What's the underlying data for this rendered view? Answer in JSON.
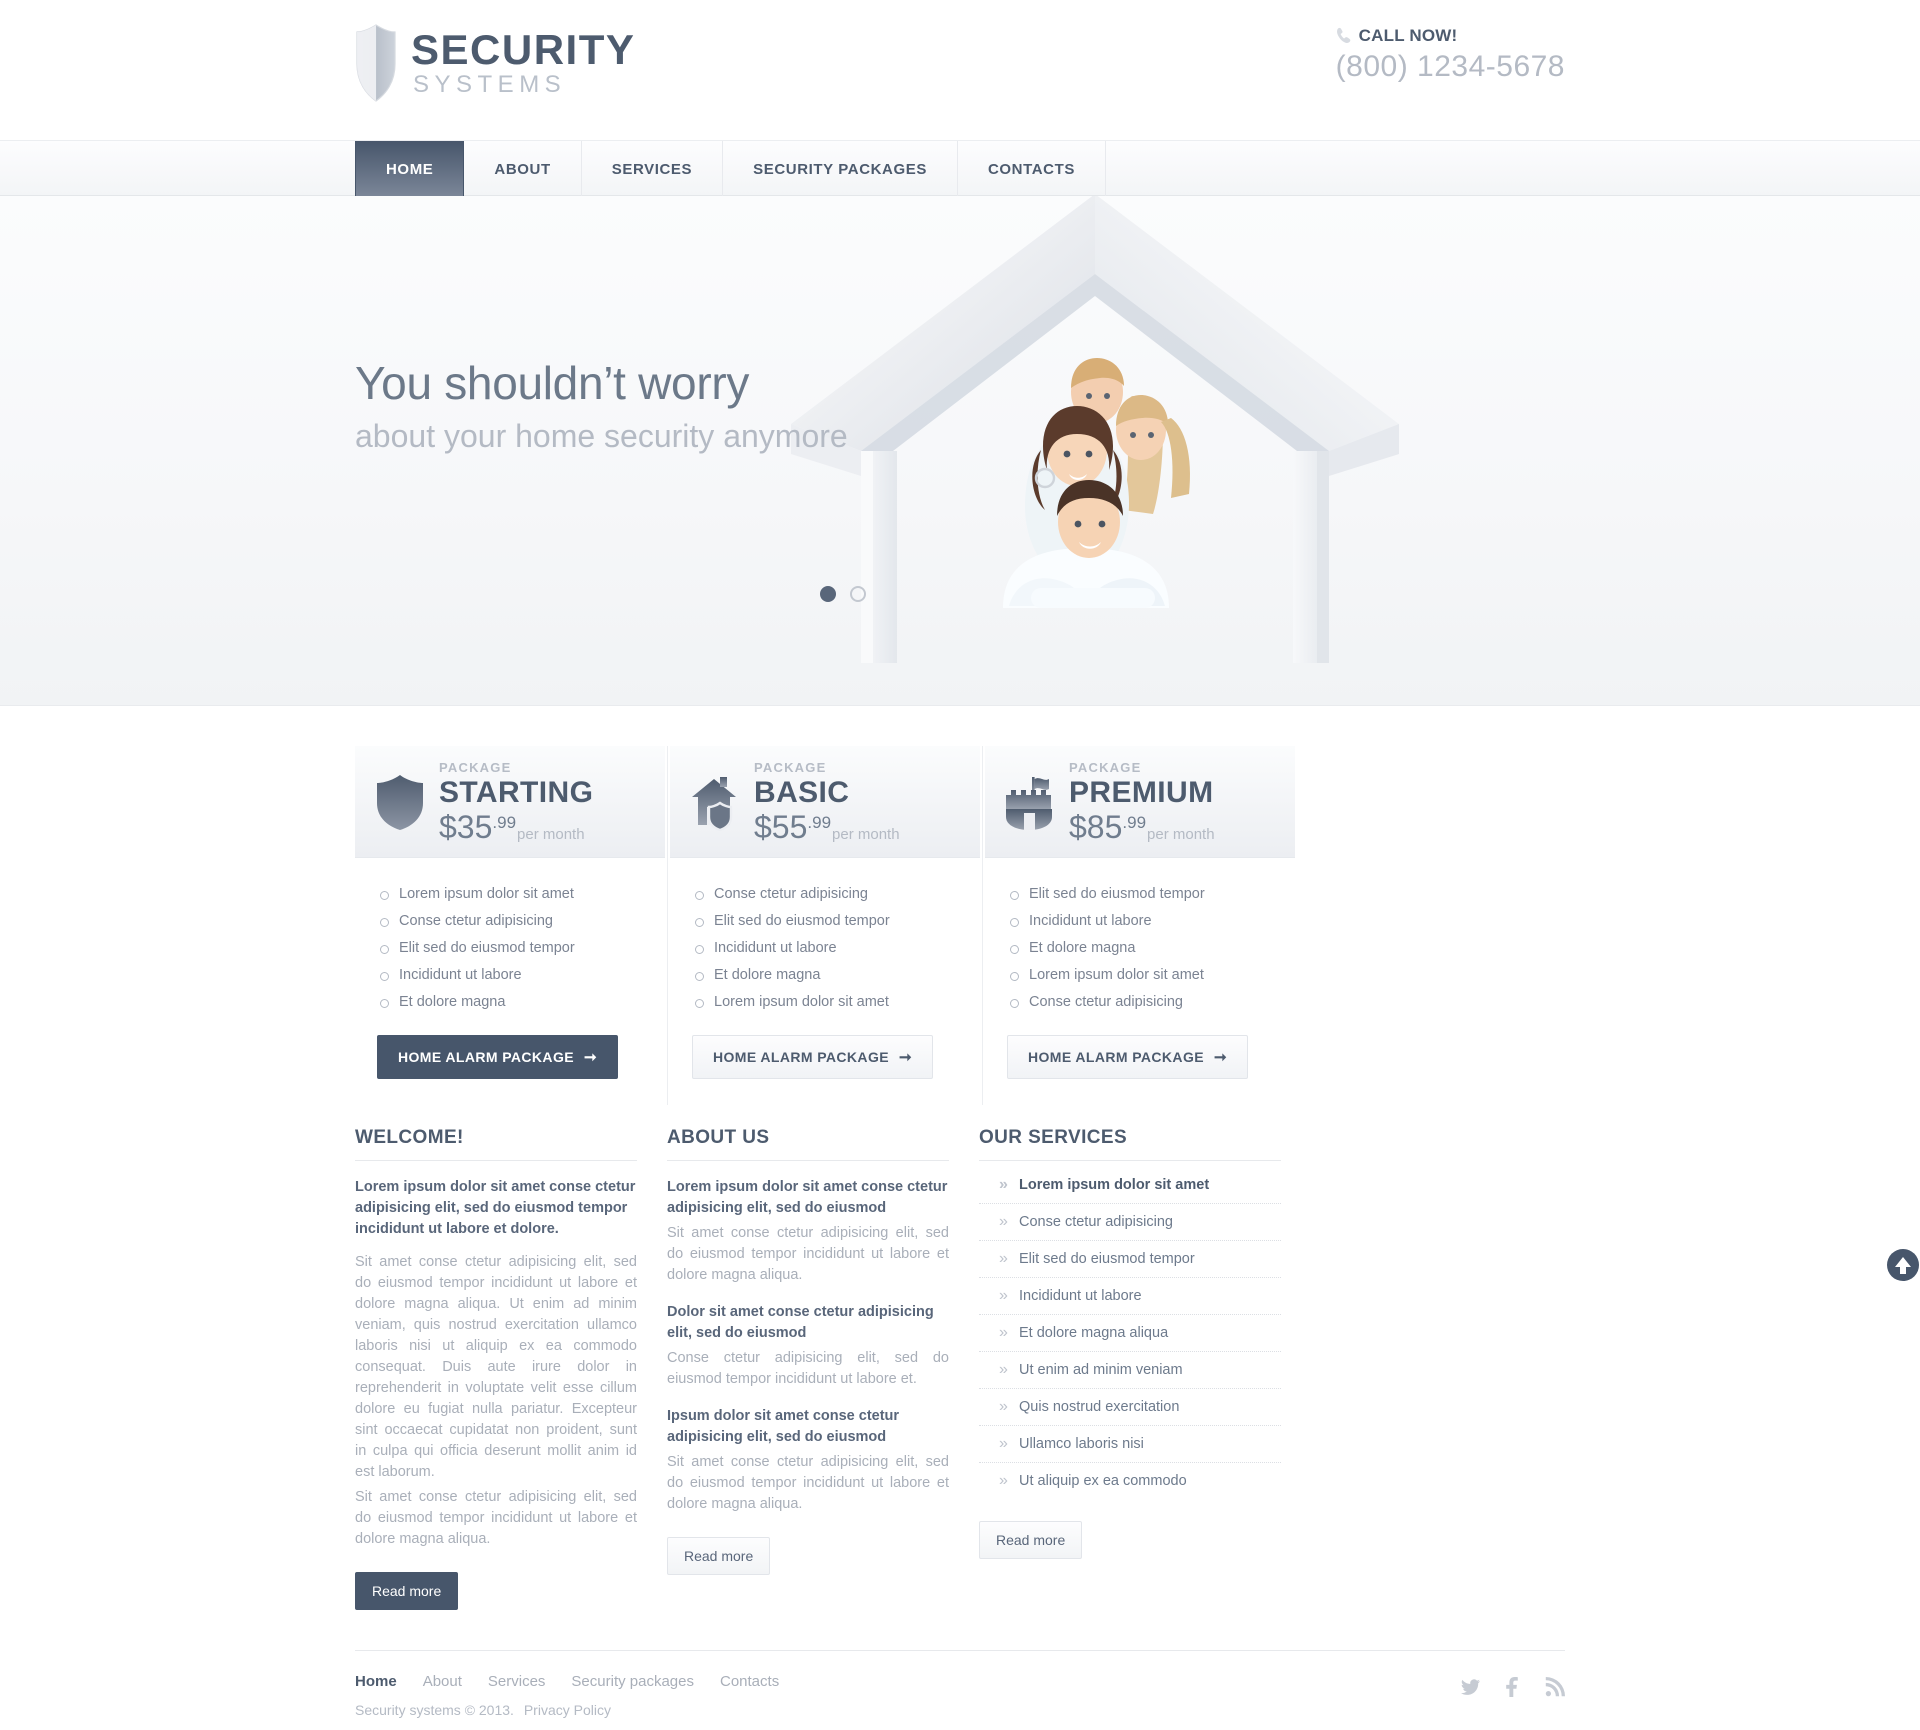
{
  "header": {
    "logo": {
      "title": "SECURITY",
      "subtitle": "SYSTEMS",
      "icon": "shield-icon"
    },
    "call_label": "CALL NOW!",
    "call_icon": "phone-icon",
    "phone": "(800) 1234-5678"
  },
  "nav": {
    "items": [
      {
        "label": "HOME",
        "active": true
      },
      {
        "label": "ABOUT",
        "active": false
      },
      {
        "label": "SERVICES",
        "active": false
      },
      {
        "label": "SECURITY PACKAGES",
        "active": false
      },
      {
        "label": "CONTACTS",
        "active": false
      }
    ]
  },
  "slider": {
    "headline": "You shouldn’t worry",
    "subheadline": "about your home security anymore",
    "image_alt": "family-under-house-icon",
    "pager": {
      "total": 2,
      "active": 1
    }
  },
  "packages": [
    {
      "icon": "shield-icon",
      "label": "PACKAGE",
      "name": "STARTING",
      "price": "$35",
      "cents": ".99",
      "period": "per month",
      "features": [
        "Lorem ipsum dolor sit amet",
        "Conse ctetur adipisicing",
        "Elit sed do eiusmod tempor",
        "Incididunt ut labore",
        "Et dolore magna"
      ],
      "button": "HOME ALARM PACKAGE",
      "button_style": "dark"
    },
    {
      "icon": "house-shield-icon",
      "label": "PACKAGE",
      "name": "BASIC",
      "price": "$55",
      "cents": ".99",
      "period": "per month",
      "features": [
        "Conse ctetur adipisicing",
        "Elit sed do eiusmod tempor",
        "Incididunt ut labore",
        "Et dolore magna",
        "Lorem ipsum dolor sit amet"
      ],
      "button": "HOME ALARM PACKAGE",
      "button_style": "light"
    },
    {
      "icon": "castle-flag-icon",
      "label": "PACKAGE",
      "name": "PREMIUM",
      "price": "$85",
      "cents": ".99",
      "period": "per month",
      "features": [
        "Elit sed do eiusmod tempor",
        "Incididunt ut labore",
        "Et dolore magna",
        "Lorem ipsum dolor sit amet",
        "Conse ctetur adipisicing"
      ],
      "button": "HOME ALARM PACKAGE",
      "button_style": "light"
    }
  ],
  "welcome": {
    "title": "WELCOME!",
    "lead": "Lorem ipsum dolor sit amet conse ctetur adipisicing elit, sed do eiusmod tempor incididunt ut labore et dolore.",
    "body1": "Sit amet conse ctetur adipisicing elit, sed do eiusmod tempor incididunt ut labore et dolore magna aliqua. Ut enim ad minim veniam, quis nostrud exercitation ullamco laboris nisi ut aliquip ex ea commodo consequat. Duis aute irure dolor in reprehenderit in voluptate velit esse cillum dolore eu fugiat nulla pariatur. Excepteur sint occaecat cupidatat non proident, sunt in culpa qui officia deserunt mollit anim id est laborum.",
    "body2": "Sit amet conse ctetur adipisicing elit, sed do eiusmod tempor incididunt ut labore et dolore magna aliqua.",
    "read_more": "Read more"
  },
  "about": {
    "title": "ABOUT US",
    "block1_title": "Lorem ipsum dolor sit amet conse ctetur adipisicing elit, sed do eiusmod",
    "block1_body": "Sit amet conse ctetur adipisicing elit, sed do eiusmod tempor incididunt ut labore et dolore magna aliqua.",
    "block2_title": "Dolor sit amet conse ctetur adipisicing elit, sed do eiusmod",
    "block2_body": "Conse ctetur adipisicing elit, sed do eiusmod tempor incididunt ut labore et.",
    "block3_title": "Ipsum dolor sit amet conse ctetur adipisicing elit, sed do eiusmod",
    "block3_body": "Sit amet conse ctetur adipisicing elit, sed do eiusmod tempor incididunt ut labore et dolore magna aliqua.",
    "read_more": "Read more"
  },
  "services": {
    "title": "OUR SERVICES",
    "items": [
      "Lorem ipsum dolor sit amet",
      "Conse ctetur adipisicing",
      "Elit sed do eiusmod tempor",
      "Incididunt ut labore",
      "Et dolore magna aliqua",
      "Ut enim ad minim veniam",
      "Quis nostrud exercitation",
      "Ullamco laboris nisi",
      "Ut aliquip ex ea commodo"
    ],
    "read_more": "Read more"
  },
  "back_to_top": {
    "icon": "arrow-up-circle-icon"
  },
  "footer": {
    "links": [
      {
        "label": "Home",
        "active": true
      },
      {
        "label": "About",
        "active": false
      },
      {
        "label": "Services",
        "active": false
      },
      {
        "label": "Security packages",
        "active": false
      },
      {
        "label": "Contacts",
        "active": false
      }
    ],
    "copyright": "Security systems © 2013.",
    "privacy": "Privacy Policy",
    "social": [
      {
        "icon": "twitter-icon"
      },
      {
        "icon": "facebook-icon"
      },
      {
        "icon": "rss-icon"
      }
    ]
  },
  "colors": {
    "accent_dark": "#47566b",
    "text_dark": "#4d5b6e",
    "text_muted": "#a9afb9"
  }
}
